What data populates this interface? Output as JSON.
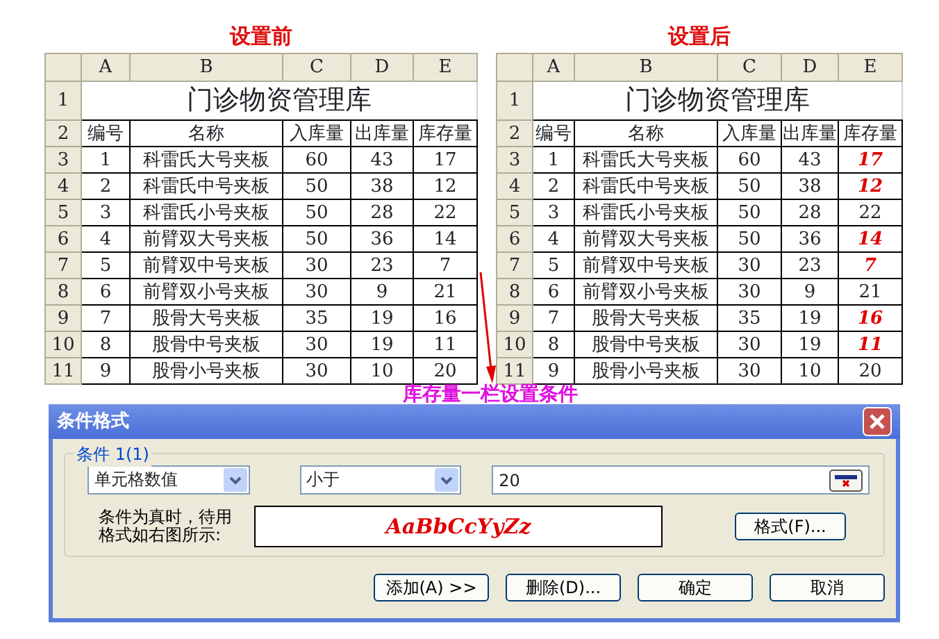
{
  "sheets": [
    {
      "caption": "设置前",
      "col_headers": [
        "A",
        "B",
        "C",
        "D",
        "E"
      ],
      "title_row": "1",
      "title": "门诊物资管理库",
      "header_row": "2",
      "headers": [
        "编号",
        "名称",
        "入库量",
        "出库量",
        "库存量"
      ],
      "rows": [
        {
          "row_num": "3",
          "cells": [
            "1",
            "科雷氏大号夹板",
            "60",
            "43",
            "17"
          ],
          "highlight": false
        },
        {
          "row_num": "4",
          "cells": [
            "2",
            "科雷氏中号夹板",
            "50",
            "38",
            "12"
          ],
          "highlight": false
        },
        {
          "row_num": "5",
          "cells": [
            "3",
            "科雷氏小号夹板",
            "50",
            "28",
            "22"
          ],
          "highlight": false
        },
        {
          "row_num": "6",
          "cells": [
            "4",
            "前臂双大号夹板",
            "50",
            "36",
            "14"
          ],
          "highlight": false
        },
        {
          "row_num": "7",
          "cells": [
            "5",
            "前臂双中号夹板",
            "30",
            "23",
            "7"
          ],
          "highlight": false
        },
        {
          "row_num": "8",
          "cells": [
            "6",
            "前臂双小号夹板",
            "30",
            "9",
            "21"
          ],
          "highlight": false
        },
        {
          "row_num": "9",
          "cells": [
            "7",
            "股骨大号夹板",
            "35",
            "19",
            "16"
          ],
          "highlight": false
        },
        {
          "row_num": "10",
          "cells": [
            "8",
            "股骨中号夹板",
            "30",
            "19",
            "11"
          ],
          "highlight": false
        },
        {
          "row_num": "11",
          "cells": [
            "9",
            "股骨小号夹板",
            "30",
            "10",
            "20"
          ],
          "highlight": false
        }
      ]
    },
    {
      "caption": "设置后",
      "col_headers": [
        "A",
        "B",
        "C",
        "D",
        "E"
      ],
      "title_row": "1",
      "title": "门诊物资管理库",
      "header_row": "2",
      "headers": [
        "编号",
        "名称",
        "入库量",
        "出库量",
        "库存量"
      ],
      "rows": [
        {
          "row_num": "3",
          "cells": [
            "1",
            "科雷氏大号夹板",
            "60",
            "43",
            "17"
          ],
          "highlight": true
        },
        {
          "row_num": "4",
          "cells": [
            "2",
            "科雷氏中号夹板",
            "50",
            "38",
            "12"
          ],
          "highlight": true
        },
        {
          "row_num": "5",
          "cells": [
            "3",
            "科雷氏小号夹板",
            "50",
            "28",
            "22"
          ],
          "highlight": false
        },
        {
          "row_num": "6",
          "cells": [
            "4",
            "前臂双大号夹板",
            "50",
            "36",
            "14"
          ],
          "highlight": true
        },
        {
          "row_num": "7",
          "cells": [
            "5",
            "前臂双中号夹板",
            "30",
            "23",
            "7"
          ],
          "highlight": true
        },
        {
          "row_num": "8",
          "cells": [
            "6",
            "前臂双小号夹板",
            "30",
            "9",
            "21"
          ],
          "highlight": false
        },
        {
          "row_num": "9",
          "cells": [
            "7",
            "股骨大号夹板",
            "35",
            "19",
            "16"
          ],
          "highlight": true
        },
        {
          "row_num": "10",
          "cells": [
            "8",
            "股骨中号夹板",
            "30",
            "19",
            "11"
          ],
          "highlight": true
        },
        {
          "row_num": "11",
          "cells": [
            "9",
            "股骨小号夹板",
            "30",
            "10",
            "20"
          ],
          "highlight": false
        }
      ]
    }
  ],
  "annotation": "库存量一栏设置条件",
  "dialog": {
    "title": "条件格式",
    "group_label": "条件 1(1)",
    "field_type": "单元格数值",
    "operator": "小于",
    "value": "20",
    "hint": "条件为真时，待用格式如右图所示:",
    "preview": "AaBbCcYyZz",
    "format_button": "格式(F)...",
    "buttons": [
      "添加(A) >>",
      "删除(D)...",
      "确定",
      "取消"
    ]
  }
}
